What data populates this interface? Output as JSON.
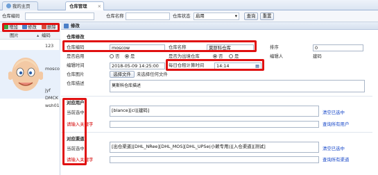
{
  "tabs": [
    {
      "label": "我的主页"
    },
    {
      "label": "仓库管理"
    }
  ],
  "search": {
    "code_label": "仓库编码",
    "name_label": "仓库名称",
    "status_label": "仓库状态",
    "status_value": "启用",
    "query_button": "查询",
    "reset_button": "重置"
  },
  "left": {
    "toolbar": {
      "add": "增加",
      "edit": "修改",
      "delete": "删除"
    },
    "columns": {
      "image": "图片",
      "code": "编码"
    },
    "rows": [
      "123",
      "mosco",
      "jyf",
      "DMCK",
      "wsh01"
    ]
  },
  "panel_title": "修改",
  "form": {
    "section_title": "仓库修改",
    "code_label": "仓库编码",
    "code_value": "moscow",
    "name_label": "仓库名称",
    "name_value": "莫斯科仓库",
    "sort_label": "排序",
    "sort_value": "0",
    "enabled_label": "是否启用",
    "enabled_no": "否",
    "enabled_yes": "是",
    "outbound_label": "是否为出境仓库",
    "outbound_no": "否",
    "outbound_yes": "是",
    "editor_label": "编辑人",
    "editor_value": "建码",
    "edit_time_label": "编辑时间",
    "edit_time_value": "2018-05-09 14:25:00",
    "daily_calc_label": "每日仓租计算时间",
    "daily_calc_value": "14:14",
    "image_label": "仓库图片",
    "choose_file": "选择文件",
    "no_file": "未选择任何文件",
    "desc_label": "仓库描述",
    "desc_value": "莫斯科仓库描述"
  },
  "users": {
    "section_title": "对应用户",
    "selected_label": "当前选中",
    "selected_value": "[blance][cl][建码]",
    "clear_link": "清空已选中",
    "keyword_label": "请输入关键字",
    "query_all_link": "查询所有用户"
  },
  "channels": {
    "section_title": "对应渠道",
    "selected_label": "当前选中",
    "selected_value": "[出仓渠道][DHL_NRee][DHL_MOS][DHL_UPSe(小赖专用)][入仓渠道][测试]",
    "clear_link": "清空已选中",
    "keyword_label": "请输入关键字",
    "query_all_link": "查询所有渠道"
  },
  "colors": {
    "highlight": "#e01111",
    "link": "#1546c8",
    "required": "#d40000"
  }
}
